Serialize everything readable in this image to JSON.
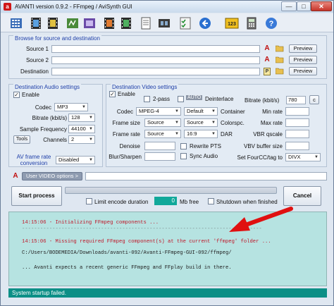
{
  "window": {
    "title": "AVANTI  version  0.9.2  -  FFmpeg / AviSynth GUI",
    "app_icon": "a",
    "minimize": "—",
    "maximize": "□",
    "close": "✕"
  },
  "toolbar": {
    "icons": [
      "preset-grid-icon",
      "film-icon",
      "film-icon",
      "audio-icon",
      "video-icon",
      "film-icon",
      "film-icon",
      "document-icon",
      "filmstrip-icon",
      "checklist-icon",
      "play-arrow-icon",
      "number-icon",
      "calculator-icon",
      "help-icon"
    ],
    "number_icon_text": "123"
  },
  "browse": {
    "title": "Browse for source and destination",
    "source1_label": "Source 1",
    "source2_label": "Source 2",
    "destination_label": "Destination",
    "preview_label": "Preview",
    "avisynth_icon_text": "A",
    "p_icon_text": "P"
  },
  "audio": {
    "title": "Destination Audio settings",
    "enable_label": "Enable",
    "enable_checked": "✓",
    "codec_label": "Codec",
    "codec_value": "MP3",
    "bitrate_label": "Bitrate (kbit/s)",
    "bitrate_value": "128",
    "samplefreq_label": "Sample Frequency",
    "samplefreq_value": "44100",
    "tools_label": "Tools",
    "channels_label": "Channels",
    "channels_value": "2",
    "avframerate_label": "AV frame rate conversion",
    "avframerate_value": "Disabled"
  },
  "video": {
    "title": "Destination Video settings",
    "enable_label": "Enable",
    "enable_checked": "✓",
    "twopass_label": "2-pass",
    "auto_label": "AUTO",
    "deinterlace_label": "Deinterlace",
    "bitrate_label": "Bitrate (kbit/s)",
    "bitrate_value": "780",
    "c_button": "c",
    "codec_label": "Codec",
    "codec_value": "MPEG-4",
    "container_combo": "Default",
    "container_label": "Container",
    "minrate_label": "Min rate",
    "framesize_label": "Frame size",
    "framesize_value": "Source",
    "colorspc_combo": "Source",
    "colorspc_label": "Colorspc.",
    "maxrate_label": "Max rate",
    "framerate_label": "Frame rate",
    "framerate_value": "Source",
    "dar_combo": "16:9",
    "dar_label": "DAR",
    "vbrqscale_label": "VBR qscale",
    "denoise_label": "Denoise",
    "rewritepts_label": "Rewrite PTS",
    "vbvbuffer_label": "VBV buffer size",
    "blursharpen_label": "Blur/Sharpen",
    "syncaudio_label": "Sync Audio",
    "fourcc_label": "Set FourCC/tag to",
    "fourcc_value": "DIVX"
  },
  "user_options": {
    "button_label": "User VIDEO options >"
  },
  "process": {
    "start_label": "Start process",
    "cancel_label": "Cancel",
    "limit_label": "Limit encode duration",
    "mbfree_value": "0",
    "mbfree_label": "Mb free",
    "shutdown_label": "Shutdown when finished",
    "progress": 0
  },
  "log": {
    "lines": [
      "14:15:06 - Initializing FFmpeg components ...",
      "-------------------------------------------------------------------------------",
      "14:15:06 - Missing required FFmpeg component(s) at the current 'ffmpeg' folder ...",
      "C:/Users/BODEMEDIA/Downloads/avanti-092/Avanti-FFmpeg-GUI-092/ffmpeg/",
      "... Avanti expects a recent generic FFmpeg and FFplay build in there."
    ],
    "colors": [
      "#c0182a",
      "#c0182a",
      "#c0182a",
      "#222222",
      "#222222"
    ]
  },
  "status": {
    "text": "System startup failed."
  },
  "colors": {
    "accent": "#1f3fa8",
    "log_bg": "#b6e3e1",
    "status_bg": "#0c8f86",
    "error_text": "#c0182a",
    "annotation_arrow": "#e01010"
  }
}
